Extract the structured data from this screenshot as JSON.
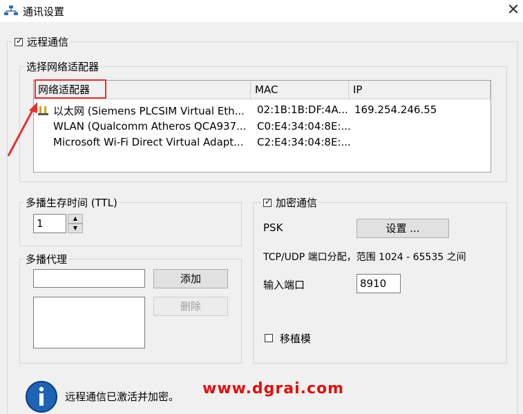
{
  "window": {
    "title": "通讯设置",
    "close_glyph": "✕"
  },
  "remote": {
    "label": "远程通信",
    "checked": true
  },
  "adapter_group": {
    "label": "选择网络适配器",
    "columns": [
      "网络适配器",
      "MAC",
      "IP"
    ],
    "rows": [
      {
        "name": "以太网 (Siemens PLCSIM Virtual Eth...",
        "mac": "02:1B:1B:DF:4A...",
        "ip": "169.254.246.55"
      },
      {
        "name": "WLAN (Qualcomm Atheros QCA937...",
        "mac": "C0:E4:34:04:8E:...",
        "ip": ""
      },
      {
        "name": "Microsoft Wi-Fi Direct Virtual Adapt...",
        "mac": "C2:E4:34:04:8E:...",
        "ip": ""
      }
    ]
  },
  "ttl_group": {
    "label": "多播生存时间 (TTL)",
    "value": "1"
  },
  "proxy_group": {
    "label": "多播代理",
    "add_label": "添加",
    "delete_label": "删除"
  },
  "encrypt_group": {
    "label": "加密通信",
    "checked": true,
    "psk_label": "PSK",
    "settings_button": "设置 ...",
    "port_info": "TCP/UDP 端口分配，范围 1024 - 65535 之间",
    "port_label": "输入端口",
    "port_value": "8910",
    "migration_label": "移植模",
    "migration_checked": false
  },
  "status": {
    "text": "远程通信已激活并加密。"
  },
  "watermark": "www.dgrai.com",
  "colors": {
    "annotation_red": "#e53030",
    "watermark_red": "#e01010"
  }
}
